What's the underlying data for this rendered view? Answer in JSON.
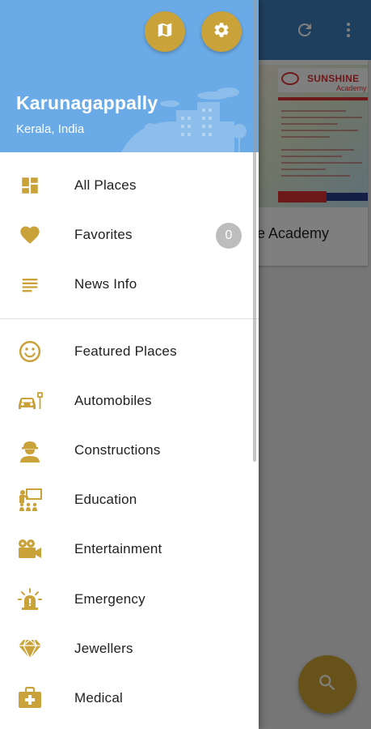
{
  "colors": {
    "accent": "#c9a23a",
    "header_bg": "#6aaae6",
    "appbar_bg": "#3f7fbf",
    "count_badge": "#bdbdbd"
  },
  "appbar": {
    "icons": [
      "refresh-icon",
      "more-vert-icon"
    ]
  },
  "card": {
    "title_fragment": "e Academy",
    "image_brand": "SUNSHINE",
    "image_brand_sub": "Academy"
  },
  "fab": {
    "icon": "search-icon"
  },
  "drawer": {
    "header": {
      "place": "Karunagappally",
      "region": "Kerala, India",
      "buttons": [
        "map-icon",
        "settings-icon"
      ]
    },
    "primary_items": [
      {
        "label": "All Places",
        "icon": "dashboard-icon"
      },
      {
        "label": "Favorites",
        "icon": "heart-icon",
        "count": "0"
      },
      {
        "label": "News Info",
        "icon": "list-icon"
      }
    ],
    "category_items": [
      {
        "label": "Featured Places",
        "icon": "smiley-icon"
      },
      {
        "label": "Automobiles",
        "icon": "car-icon"
      },
      {
        "label": "Constructions",
        "icon": "worker-icon"
      },
      {
        "label": "Education",
        "icon": "classroom-icon"
      },
      {
        "label": "Entertainment",
        "icon": "video-camera-icon"
      },
      {
        "label": "Emergency",
        "icon": "alarm-light-icon"
      },
      {
        "label": "Jewellers",
        "icon": "diamond-icon"
      },
      {
        "label": "Medical",
        "icon": "medical-kit-icon"
      }
    ]
  }
}
